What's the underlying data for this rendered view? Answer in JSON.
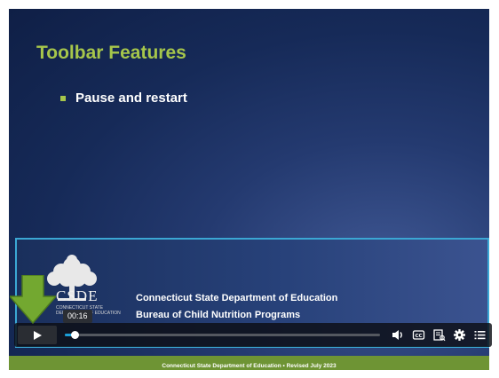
{
  "slide": {
    "title": "Toolbar Features",
    "bullets": [
      {
        "text": "Pause and restart"
      }
    ]
  },
  "footer": {
    "logo_text": "CSDE",
    "logo_sub1": "CONNECTICUT STATE",
    "logo_sub2": "DEPARTMENT OF EDUCATION",
    "department": "Connecticut State Department of Education",
    "bureau": "Bureau of Child Nutrition Programs",
    "caption": "Connecticut State Department of Education • Revised July 2023"
  },
  "player": {
    "time_tooltip": "00:16",
    "progress_fraction": 0.03,
    "controls": [
      {
        "name": "volume-icon"
      },
      {
        "name": "closed-captions-icon"
      },
      {
        "name": "transcript-icon"
      },
      {
        "name": "settings-gear-icon"
      },
      {
        "name": "chapters-menu-icon"
      }
    ]
  },
  "colors": {
    "accent_green": "#a6c64b",
    "band_green": "#6e9434",
    "progress_blue": "#1a9fd9",
    "frame_blue": "#3ba7d4"
  }
}
